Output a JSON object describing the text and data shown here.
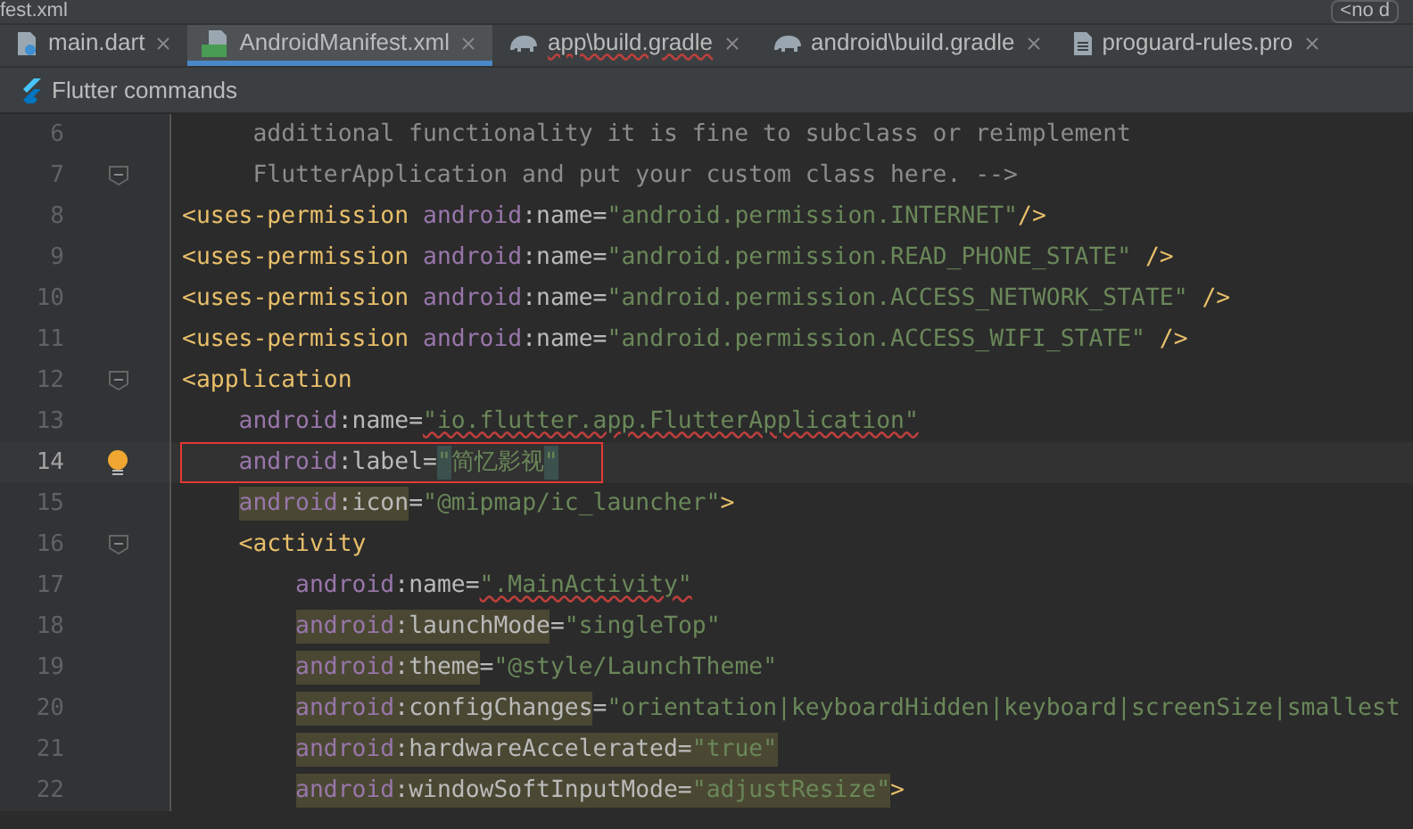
{
  "window": {
    "title_fragment": "fest.xml",
    "selector_text": "<no d"
  },
  "tabs": [
    {
      "label": "main.dart",
      "kind": "dart",
      "selected": false,
      "misspelled": false
    },
    {
      "label": "AndroidManifest.xml",
      "kind": "manifest",
      "selected": true,
      "misspelled": false
    },
    {
      "label": "app\\build.gradle",
      "kind": "gradle",
      "selected": false,
      "misspelled": true
    },
    {
      "label": "android\\build.gradle",
      "kind": "gradle",
      "selected": false,
      "misspelled": false
    },
    {
      "label": "proguard-rules.pro",
      "kind": "text",
      "selected": false,
      "misspelled": false
    }
  ],
  "toolbar": {
    "label": "Flutter commands"
  },
  "lines": [
    {
      "number": "6",
      "current": false,
      "boxed": false,
      "fold": false,
      "bulb": false,
      "tokens": [
        {
          "kind": "comment",
          "text": "     additional functionality it is fine to subclass or reimplement"
        }
      ]
    },
    {
      "number": "7",
      "current": false,
      "boxed": false,
      "fold": true,
      "bulb": false,
      "tokens": [
        {
          "kind": "comment",
          "text": "     FlutterApplication and put your custom class here. -->"
        }
      ]
    },
    {
      "number": "8",
      "current": false,
      "boxed": false,
      "fold": false,
      "bulb": false,
      "tokens": [
        {
          "kind": "tag",
          "text": "<uses-permission"
        },
        {
          "kind": "ns",
          "text": " android"
        },
        {
          "kind": "punct",
          "text": ":"
        },
        {
          "kind": "attr",
          "text": "name"
        },
        {
          "kind": "punct",
          "text": "="
        },
        {
          "kind": "string",
          "text": "\"android.permission.INTERNET\""
        },
        {
          "kind": "tag",
          "text": "/>"
        }
      ]
    },
    {
      "number": "9",
      "current": false,
      "boxed": false,
      "fold": false,
      "bulb": false,
      "tokens": [
        {
          "kind": "tag",
          "text": "<uses-permission"
        },
        {
          "kind": "ns",
          "text": " android"
        },
        {
          "kind": "punct",
          "text": ":"
        },
        {
          "kind": "attr",
          "text": "name"
        },
        {
          "kind": "punct",
          "text": "="
        },
        {
          "kind": "string",
          "text": "\"android.permission.READ_PHONE_STATE\""
        },
        {
          "kind": "tag",
          "text": " />"
        }
      ]
    },
    {
      "number": "10",
      "current": false,
      "boxed": false,
      "fold": false,
      "bulb": false,
      "tokens": [
        {
          "kind": "tag",
          "text": "<uses-permission"
        },
        {
          "kind": "ns",
          "text": " android"
        },
        {
          "kind": "punct",
          "text": ":"
        },
        {
          "kind": "attr",
          "text": "name"
        },
        {
          "kind": "punct",
          "text": "="
        },
        {
          "kind": "string",
          "text": "\"android.permission.ACCESS_NETWORK_STATE\""
        },
        {
          "kind": "tag",
          "text": " />"
        }
      ]
    },
    {
      "number": "11",
      "current": false,
      "boxed": false,
      "fold": false,
      "bulb": false,
      "tokens": [
        {
          "kind": "tag",
          "text": "<uses-permission"
        },
        {
          "kind": "ns",
          "text": " android"
        },
        {
          "kind": "punct",
          "text": ":"
        },
        {
          "kind": "attr",
          "text": "name"
        },
        {
          "kind": "punct",
          "text": "="
        },
        {
          "kind": "string",
          "text": "\"android.permission.ACCESS_WIFI_STATE\""
        },
        {
          "kind": "tag",
          "text": " />"
        }
      ]
    },
    {
      "number": "12",
      "current": false,
      "boxed": false,
      "fold": true,
      "bulb": false,
      "tokens": [
        {
          "kind": "tag",
          "text": "<application"
        }
      ]
    },
    {
      "number": "13",
      "current": false,
      "boxed": false,
      "fold": false,
      "bulb": false,
      "tokens": [
        {
          "kind": "ns",
          "text": "    android"
        },
        {
          "kind": "punct",
          "text": ":"
        },
        {
          "kind": "attr",
          "text": "name"
        },
        {
          "kind": "punct",
          "text": "="
        },
        {
          "kind": "string",
          "text": "\"io.flutter.app.FlutterApplication\"",
          "misspelled": true
        }
      ]
    },
    {
      "number": "14",
      "current": true,
      "boxed": true,
      "fold": false,
      "bulb": true,
      "tokens": [
        {
          "kind": "ns",
          "text": "    android"
        },
        {
          "kind": "punct",
          "text": ":"
        },
        {
          "kind": "attr",
          "text": "label"
        },
        {
          "kind": "punct",
          "text": "="
        },
        {
          "kind": "string",
          "text": "\"",
          "matched": true
        },
        {
          "kind": "string",
          "text": "简忆影视"
        },
        {
          "kind": "string",
          "text": "\"",
          "matched": true
        }
      ]
    },
    {
      "number": "15",
      "current": false,
      "boxed": false,
      "fold": false,
      "bulb": false,
      "tokens": [
        {
          "kind": "ns",
          "text": "    android",
          "highlighted": true
        },
        {
          "kind": "punct",
          "text": ":",
          "highlighted": true
        },
        {
          "kind": "attr",
          "text": "icon",
          "highlighted": true
        },
        {
          "kind": "punct",
          "text": "="
        },
        {
          "kind": "string",
          "text": "\"@mipmap/ic_launcher\""
        },
        {
          "kind": "tag",
          "text": ">"
        }
      ]
    },
    {
      "number": "16",
      "current": false,
      "boxed": false,
      "fold": true,
      "bulb": false,
      "tokens": [
        {
          "kind": "tag",
          "text": "    <activity"
        }
      ]
    },
    {
      "number": "17",
      "current": false,
      "boxed": false,
      "fold": false,
      "bulb": false,
      "tokens": [
        {
          "kind": "ns",
          "text": "        android"
        },
        {
          "kind": "punct",
          "text": ":"
        },
        {
          "kind": "attr",
          "text": "name"
        },
        {
          "kind": "punct",
          "text": "="
        },
        {
          "kind": "string",
          "text": "\".MainActivity\"",
          "misspelled": true
        }
      ]
    },
    {
      "number": "18",
      "current": false,
      "boxed": false,
      "fold": false,
      "bulb": false,
      "tokens": [
        {
          "kind": "ns",
          "text": "        android",
          "highlighted": true
        },
        {
          "kind": "punct",
          "text": ":",
          "highlighted": true
        },
        {
          "kind": "attr",
          "text": "launchMode",
          "highlighted": true
        },
        {
          "kind": "punct",
          "text": "="
        },
        {
          "kind": "string",
          "text": "\"singleTop\""
        }
      ]
    },
    {
      "number": "19",
      "current": false,
      "boxed": false,
      "fold": false,
      "bulb": false,
      "tokens": [
        {
          "kind": "ns",
          "text": "        android",
          "highlighted": true
        },
        {
          "kind": "punct",
          "text": ":",
          "highlighted": true
        },
        {
          "kind": "attr",
          "text": "theme",
          "highlighted": true
        },
        {
          "kind": "punct",
          "text": "="
        },
        {
          "kind": "string",
          "text": "\"@style/LaunchTheme\""
        }
      ]
    },
    {
      "number": "20",
      "current": false,
      "boxed": false,
      "fold": false,
      "bulb": false,
      "tokens": [
        {
          "kind": "ns",
          "text": "        android",
          "highlighted": true
        },
        {
          "kind": "punct",
          "text": ":",
          "highlighted": true
        },
        {
          "kind": "attr",
          "text": "configChanges",
          "highlighted": true
        },
        {
          "kind": "punct",
          "text": "="
        },
        {
          "kind": "string",
          "text": "\"orientation|keyboardHidden|keyboard|screenSize|smallest"
        }
      ]
    },
    {
      "number": "21",
      "current": false,
      "boxed": false,
      "fold": false,
      "bulb": false,
      "tokens": [
        {
          "kind": "ns",
          "text": "        android",
          "highlighted": true
        },
        {
          "kind": "punct",
          "text": ":",
          "highlighted": true
        },
        {
          "kind": "attr",
          "text": "hardwareAccelerated",
          "highlighted": true
        },
        {
          "kind": "punct",
          "text": "=",
          "highlighted": true
        },
        {
          "kind": "string",
          "text": "\"true\"",
          "highlighted": true
        }
      ]
    },
    {
      "number": "22",
      "current": false,
      "boxed": false,
      "fold": false,
      "bulb": false,
      "tokens": [
        {
          "kind": "ns",
          "text": "        android",
          "highlighted": true
        },
        {
          "kind": "punct",
          "text": ":",
          "highlighted": true
        },
        {
          "kind": "attr",
          "text": "windowSoftInputMode",
          "highlighted": true
        },
        {
          "kind": "punct",
          "text": "=",
          "highlighted": true
        },
        {
          "kind": "string",
          "text": "\"adjustResize\"",
          "highlighted": true
        },
        {
          "kind": "tag",
          "text": ">"
        }
      ]
    }
  ]
}
